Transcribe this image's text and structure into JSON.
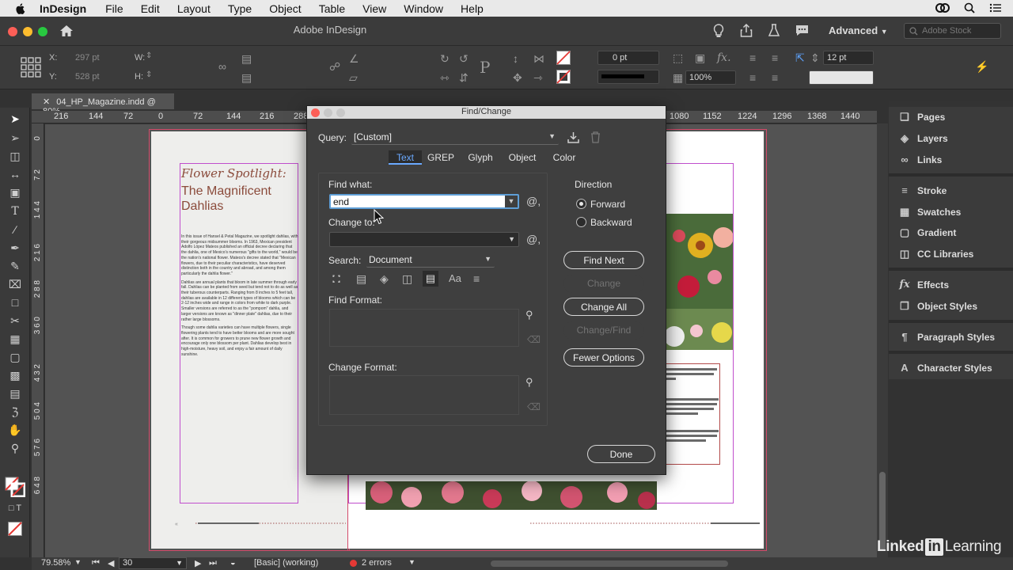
{
  "menubar": {
    "app": "InDesign",
    "items": [
      "File",
      "Edit",
      "Layout",
      "Type",
      "Object",
      "Table",
      "View",
      "Window",
      "Help"
    ]
  },
  "app_header": {
    "title": "Adobe InDesign",
    "workspace": "Advanced",
    "search_placeholder": "Adobe Stock"
  },
  "control_panel": {
    "x_label": "X:",
    "x_value": "297 pt",
    "y_label": "Y:",
    "y_value": "528 pt",
    "w_label": "W:",
    "h_label": "H:",
    "stroke_weight": "0 pt",
    "opacity": "100%",
    "font_size": "12 pt"
  },
  "document": {
    "tab_title": "04_HP_Magazine.indd @ 80%",
    "ruler_h": [
      "216",
      "144",
      "72",
      "0",
      "72",
      "144",
      "216",
      "288",
      "1080",
      "1152",
      "1224",
      "1296",
      "1368",
      "1440"
    ],
    "ruler_v": [
      "0",
      "7 2",
      "1 4 4",
      "2 1 6",
      "2 8 8",
      "3 6 0",
      "4 3 2",
      "5 0 4",
      "5 7 6",
      "6 4 8"
    ]
  },
  "article": {
    "kicker": "Flower Spotlight:",
    "title": "The Magnificent Dahlias",
    "p1": "In this issue of Hansel & Petal Magazine, we spotlight dahlias, with their gorgeous midsummer blooms. In 1963, Mexican president Adolfo López Mateos published an official decree declaring that the dahlia, one of Mexico's numerous \"gifts to the world,\" would be the nation's national flower. Mateos's decree stated that \"Mexican flowers, due to their peculiar characteristics, have deserved distinction both in the country and abroad, and among them particularly the dahlia flower.\"",
    "p2": "Dahlias are annual plants that bloom in late summer through early fall. Dahlias can be planted from seed but tend not to do as well as their tuberous counterparts. Ranging from 8 inches to 5 feet tall, dahlias are available in 12 different types of blooms which can be 2-12 inches wide and range in colors from white to dark purple. Smaller versions are referred to as the \"pompom\" dahlia, and larger versions are known as \"dinner plate\" dahlias, due to their rather large blossoms.",
    "p3": "Though some dahlia varieties can have multiple flowers, single flowering plants tend to have better blooms and are more sought after. It is common for growers to prune new flower growth and encourage only one blossom per plant. Dahlias develop best in high-moisture, heavy soil, and enjoy a fair amount of daily sunshine."
  },
  "dialog": {
    "title": "Find/Change",
    "query_label": "Query:",
    "query_value": "[Custom]",
    "tabs": [
      "Text",
      "GREP",
      "Glyph",
      "Object",
      "Color"
    ],
    "find_label": "Find what:",
    "find_value": "end",
    "change_label": "Change to:",
    "change_value": "",
    "search_label": "Search:",
    "search_value": "Document",
    "find_format_label": "Find Format:",
    "change_format_label": "Change Format:",
    "direction_label": "Direction",
    "forward_label": "Forward",
    "backward_label": "Backward",
    "buttons": {
      "find_next": "Find Next",
      "change": "Change",
      "change_all": "Change All",
      "change_find": "Change/Find",
      "fewer_options": "Fewer Options",
      "done": "Done"
    }
  },
  "panels": [
    {
      "label": "Pages",
      "icon": "pages-icon"
    },
    {
      "label": "Layers",
      "icon": "layers-icon"
    },
    {
      "label": "Links",
      "icon": "links-icon"
    },
    {
      "label": "Stroke",
      "icon": "stroke-icon"
    },
    {
      "label": "Swatches",
      "icon": "swatches-icon"
    },
    {
      "label": "Gradient",
      "icon": "gradient-icon"
    },
    {
      "label": "CC Libraries",
      "icon": "cc-libraries-icon"
    },
    {
      "label": "Effects",
      "icon": "effects-icon"
    },
    {
      "label": "Object Styles",
      "icon": "object-styles-icon"
    },
    {
      "label": "Paragraph Styles",
      "icon": "paragraph-styles-icon"
    },
    {
      "label": "Character Styles",
      "icon": "character-styles-icon"
    }
  ],
  "status_bar": {
    "zoom": "79.58%",
    "page": "30",
    "profile": "[Basic] (working)",
    "errors": "2 errors"
  },
  "watermark": {
    "linked": "Linked",
    "in": "in",
    "learning": "Learning"
  },
  "colors": {
    "error_dot": "#e53935",
    "bleed_guide": "#d44a6a",
    "margin_guide": "#c04ecd"
  }
}
